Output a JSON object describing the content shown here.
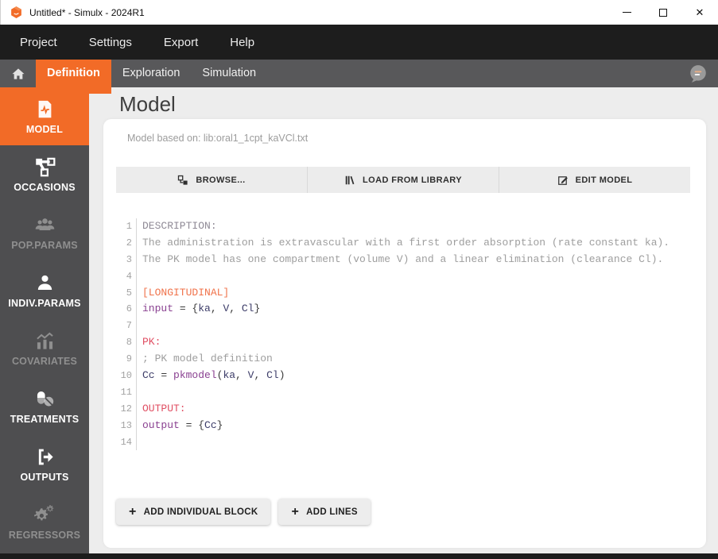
{
  "window": {
    "title": "Untitled* - Simulx - 2024R1",
    "controls": [
      {
        "name": "minimize"
      },
      {
        "name": "maximize"
      },
      {
        "name": "close"
      }
    ]
  },
  "menubar": {
    "items": [
      "Project",
      "Settings",
      "Export",
      "Help"
    ]
  },
  "tabbar": {
    "tabs": [
      {
        "label": "Definition",
        "active": true
      },
      {
        "label": "Exploration",
        "active": false
      },
      {
        "label": "Simulation",
        "active": false
      }
    ],
    "icons": [
      "home-icon",
      "messages-icon"
    ]
  },
  "sidebar": {
    "items": [
      {
        "label": "MODEL",
        "icon": "model",
        "state": "active"
      },
      {
        "label": "OCCASIONS",
        "icon": "occasions",
        "state": "enabled"
      },
      {
        "label": "POP.PARAMS",
        "icon": "pop-params",
        "state": "disabled"
      },
      {
        "label": "INDIV.PARAMS",
        "icon": "indiv-params",
        "state": "enabled"
      },
      {
        "label": "COVARIATES",
        "icon": "covariates",
        "state": "disabled"
      },
      {
        "label": "TREATMENTS",
        "icon": "treatments",
        "state": "enabled"
      },
      {
        "label": "OUTPUTS",
        "icon": "outputs",
        "state": "enabled"
      },
      {
        "label": "REGRESSORS",
        "icon": "regressors",
        "state": "disabled"
      }
    ]
  },
  "main": {
    "title": "Model",
    "based_on": "Model based on: lib:oral1_1cpt_kaVCl.txt",
    "toolbar": {
      "browse": "BROWSE...",
      "load_library": "LOAD FROM LIBRARY",
      "edit_model": "EDIT MODEL"
    },
    "actions": {
      "add_block": "ADD INDIVIDUAL BLOCK",
      "add_lines": "ADD LINES",
      "plus_glyph": "+"
    }
  },
  "editor": {
    "lines": [
      {
        "num": 1,
        "segments": [
          {
            "t": "DESCRIPTION:",
            "c": "sec-muted"
          }
        ]
      },
      {
        "num": 2,
        "segments": [
          {
            "t": "The administration is extravascular with a first order absorption (rate constant ka).",
            "c": "comment"
          }
        ]
      },
      {
        "num": 3,
        "segments": [
          {
            "t": "The PK model has one compartment (volume V) and a linear elimination (clearance Cl).",
            "c": "comment"
          }
        ]
      },
      {
        "num": 4,
        "segments": []
      },
      {
        "num": 5,
        "segments": [
          {
            "t": "[LONGITUDINAL]",
            "c": "sec-orange"
          }
        ]
      },
      {
        "num": 6,
        "segments": [
          {
            "t": "input",
            "c": "keyword"
          },
          {
            "t": " = {",
            "c": "plain"
          },
          {
            "t": "ka",
            "c": "ident"
          },
          {
            "t": ", ",
            "c": "plain"
          },
          {
            "t": "V",
            "c": "ident"
          },
          {
            "t": ", ",
            "c": "plain"
          },
          {
            "t": "Cl",
            "c": "ident"
          },
          {
            "t": "}",
            "c": "plain"
          }
        ]
      },
      {
        "num": 7,
        "segments": []
      },
      {
        "num": 8,
        "segments": [
          {
            "t": "PK:",
            "c": "sec-red"
          }
        ]
      },
      {
        "num": 9,
        "segments": [
          {
            "t": "; PK model definition",
            "c": "comment"
          }
        ]
      },
      {
        "num": 10,
        "segments": [
          {
            "t": "Cc",
            "c": "ident"
          },
          {
            "t": " = ",
            "c": "plain"
          },
          {
            "t": "pkmodel",
            "c": "keyword"
          },
          {
            "t": "(",
            "c": "plain"
          },
          {
            "t": "ka",
            "c": "ident"
          },
          {
            "t": ", ",
            "c": "plain"
          },
          {
            "t": "V",
            "c": "ident"
          },
          {
            "t": ", ",
            "c": "plain"
          },
          {
            "t": "Cl",
            "c": "ident"
          },
          {
            "t": ")",
            "c": "plain"
          }
        ]
      },
      {
        "num": 11,
        "segments": []
      },
      {
        "num": 12,
        "segments": [
          {
            "t": "OUTPUT:",
            "c": "sec-red"
          }
        ]
      },
      {
        "num": 13,
        "segments": [
          {
            "t": "output",
            "c": "keyword"
          },
          {
            "t": " = {",
            "c": "plain"
          },
          {
            "t": "Cc",
            "c": "ident"
          },
          {
            "t": "}",
            "c": "plain"
          }
        ]
      },
      {
        "num": 14,
        "segments": []
      }
    ]
  },
  "colors": {
    "accent_orange": "#f26b27",
    "menubar_bg": "#1d1d1d",
    "tabbar_bg": "#58585a",
    "sidebar_bg": "#4e4e50",
    "keyword_purple": "#8a4191",
    "identifier_navy": "#3c3c68",
    "section_red": "#e04f63",
    "section_orange": "#f0734b",
    "comment_gray": "#9e9e9e"
  }
}
